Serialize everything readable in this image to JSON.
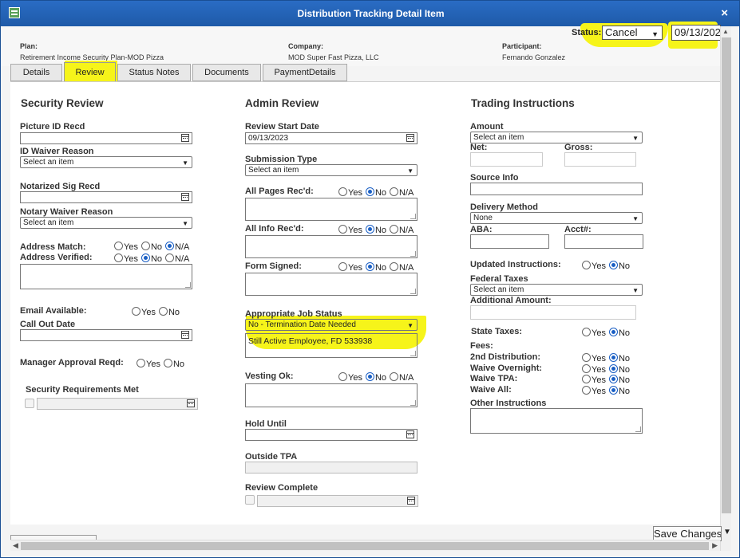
{
  "window": {
    "title": "Distribution Tracking Detail Item",
    "close_label": "×"
  },
  "header": {
    "plan_label": "Plan:",
    "plan_value": "Retirement Income Security Plan-MOD Pizza",
    "company_label": "Company:",
    "company_value": "MOD Super Fast Pizza, LLC",
    "participant_label": "Participant:",
    "participant_value": "Fernando Gonzalez",
    "status_label": "Status:",
    "status_value": "Cancel",
    "status_date": "09/13/202"
  },
  "tabs": [
    "Details",
    "Review",
    "Status Notes",
    "Documents",
    "PaymentDetails"
  ],
  "active_tab": "Review",
  "security": {
    "title": "Security Review",
    "picture_id": "Picture ID Recd",
    "id_waiver": "ID Waiver Reason",
    "id_waiver_value": "Select an item",
    "notarized": "Notarized Sig Recd",
    "notary_waiver": "Notary Waiver Reason",
    "notary_waiver_value": "Select an item",
    "address_match": "Address Match:",
    "address_verified": "Address Verified:",
    "email_available": "Email Available:",
    "call_out_date": "Call Out Date",
    "manager_approval": "Manager Approval Reqd:",
    "requirements_met": "Security Requirements Met"
  },
  "admin": {
    "title": "Admin Review",
    "review_start": "Review Start Date",
    "review_start_value": "09/13/2023",
    "submission_type": "Submission Type",
    "submission_type_value": "Select an item",
    "all_pages": "All Pages Rec'd:",
    "all_info": "All Info Rec'd:",
    "form_signed": "Form Signed:",
    "job_status": "Appropriate Job Status",
    "job_status_value": "No - Termination Date Needed",
    "job_notes": "Still Active Employee, FD 533938",
    "vesting": "Vesting Ok:",
    "hold_until": "Hold Until",
    "outside_tpa": "Outside TPA",
    "review_complete": "Review Complete"
  },
  "trading": {
    "title": "Trading Instructions",
    "amount": "Amount",
    "amount_value": "Select an item",
    "net": "Net:",
    "gross": "Gross:",
    "source_info": "Source Info",
    "delivery_method": "Delivery Method",
    "delivery_method_value": "None",
    "aba": "ABA:",
    "acct": "Acct#:",
    "updated_instructions": "Updated Instructions:",
    "federal_taxes": "Federal Taxes",
    "federal_taxes_value": "Select an item",
    "additional_amount": "Additional Amount:",
    "state_taxes": "State Taxes:",
    "fees": "Fees:",
    "second_distribution": "2nd Distribution:",
    "waive_overnight": "Waive Overnight:",
    "waive_tpa": "Waive TPA:",
    "waive_all": "Waive All:",
    "other_instructions": "Other Instructions"
  },
  "radio": {
    "yes": "Yes",
    "no": "No",
    "na": "N/A"
  },
  "footer": {
    "save_label": "Save Changes"
  },
  "colors": {
    "highlight": "#f4f614",
    "titlebar": "#1e5aa8",
    "radio_selected": "#1a5fc4"
  }
}
